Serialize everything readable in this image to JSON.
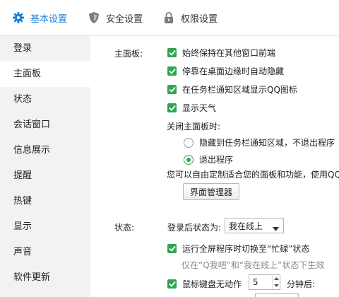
{
  "tabs": [
    {
      "label": "基本设置",
      "icon": "gear-icon",
      "active": true
    },
    {
      "label": "安全设置",
      "icon": "shield-icon",
      "active": false
    },
    {
      "label": "权限设置",
      "icon": "lock-icon",
      "active": false
    }
  ],
  "sidebar": {
    "items": [
      {
        "label": "登录"
      },
      {
        "label": "主面板"
      },
      {
        "label": "状态"
      },
      {
        "label": "会话窗口"
      },
      {
        "label": "信息展示"
      },
      {
        "label": "提醒"
      },
      {
        "label": "热键"
      },
      {
        "label": "显示"
      },
      {
        "label": "声音"
      },
      {
        "label": "软件更新"
      }
    ],
    "active_index": 1
  },
  "main_panel": {
    "section_label": "主面板:",
    "checkboxes": [
      {
        "label": "始终保持在其他窗口前端",
        "checked": true
      },
      {
        "label": "停靠在桌面边缘时自动隐藏",
        "checked": true
      },
      {
        "label": "在任务栏通知区域显示QQ图标",
        "checked": true
      },
      {
        "label": "显示天气",
        "checked": true
      }
    ],
    "close_label": "关闭主面板时:",
    "close_options": [
      {
        "label": "隐藏到任务栏通知区域，不退出程序",
        "selected": false
      },
      {
        "label": "退出程序",
        "selected": true
      }
    ],
    "customize_text": "您可以自由定制适合您的面板和功能，使用QQ",
    "manager_button": "界面管理器"
  },
  "status": {
    "section_label": "状态:",
    "login_status_label": "登录后状态为:",
    "login_status_value": "我在线上",
    "fullscreen_checkbox": {
      "label": "运行全屏程序时切换至“忙碌”状态",
      "checked": true
    },
    "hint": "仅在“Q我吧”和“我在线上”状态下生效",
    "idle_checkbox": {
      "label": "鼠标键盘无动作",
      "checked": true
    },
    "idle_minutes": "5",
    "idle_suffix": "分钟后:"
  },
  "colors": {
    "accent": "#1a7fd4",
    "check_green": "#2ea74e",
    "sidebar_bg": "#f2f2f2"
  }
}
